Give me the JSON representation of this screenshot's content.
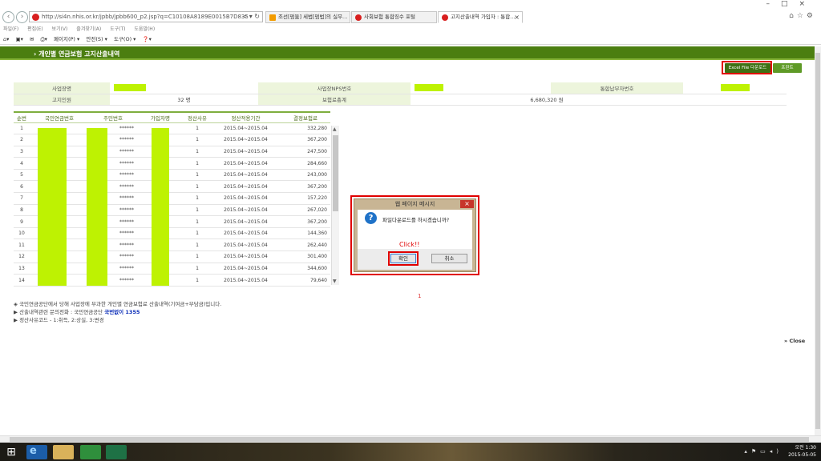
{
  "browser": {
    "url": "http://si4n.nhis.or.kr/jpbb/jpbb600_p2.jsp?q=C10108A8189E0015B7D835C979620E2'",
    "tabs": [
      {
        "label": "조선[펌뚫] 세법[펌법]의 실무..."
      },
      {
        "label": "사회보험 통합징수 포털"
      },
      {
        "label": "고지산출내역 가입자 : 통합...",
        "active": true
      }
    ],
    "menu": [
      "파일(F)",
      "편집(E)",
      "보기(V)",
      "즐겨찾기(A)",
      "도구(T)",
      "도움말(H)"
    ],
    "commands": [
      "페이지(P) ▾",
      "안전(S) ▾",
      "도구(O) ▾"
    ]
  },
  "page": {
    "title": "› 개인별 연금보험 고지산출내역",
    "excel_button": "Excel File 다운로드",
    "print_button": "프린트",
    "info": {
      "business_name_label": "사업장명",
      "nps_no_label": "사업장NPS번호",
      "integrated_payer_label": "통합납부자번호",
      "subscribers_label": "고지인원",
      "subscribers_value": "32 명",
      "total_premium_label": "보험료총계",
      "total_premium_value": "6,680,320 원"
    },
    "grid": {
      "headers": [
        "순번",
        "국민연금번호",
        "주민번호",
        "가입자명",
        "정산사유",
        "정산적용기간",
        "결정보험료"
      ],
      "rows": [
        {
          "no": "1",
          "rrn": "******",
          "reason": "1",
          "period": "2015.04~2015.04",
          "amount": "332,280"
        },
        {
          "no": "2",
          "rrn": "******",
          "reason": "1",
          "period": "2015.04~2015.04",
          "amount": "367,200"
        },
        {
          "no": "3",
          "rrn": "******",
          "reason": "1",
          "period": "2015.04~2015.04",
          "amount": "247,500"
        },
        {
          "no": "4",
          "rrn": "******",
          "reason": "1",
          "period": "2015.04~2015.04",
          "amount": "284,660"
        },
        {
          "no": "5",
          "rrn": "******",
          "reason": "1",
          "period": "2015.04~2015.04",
          "amount": "243,000"
        },
        {
          "no": "6",
          "rrn": "******",
          "reason": "1",
          "period": "2015.04~2015.04",
          "amount": "367,200"
        },
        {
          "no": "7",
          "rrn": "******",
          "reason": "1",
          "period": "2015.04~2015.04",
          "amount": "157,220"
        },
        {
          "no": "8",
          "rrn": "******",
          "reason": "1",
          "period": "2015.04~2015.04",
          "amount": "267,020"
        },
        {
          "no": "9",
          "rrn": "******",
          "reason": "1",
          "period": "2015.04~2015.04",
          "amount": "367,200"
        },
        {
          "no": "10",
          "rrn": "******",
          "reason": "1",
          "period": "2015.04~2015.04",
          "amount": "144,360"
        },
        {
          "no": "11",
          "rrn": "******",
          "reason": "1",
          "period": "2015.04~2015.04",
          "amount": "262,440"
        },
        {
          "no": "12",
          "rrn": "******",
          "reason": "1",
          "period": "2015.04~2015.04",
          "amount": "301,400"
        },
        {
          "no": "13",
          "rrn": "******",
          "reason": "1",
          "period": "2015.04~2015.04",
          "amount": "344,600"
        },
        {
          "no": "14",
          "rrn": "******",
          "reason": "1",
          "period": "2015.04~2015.04",
          "amount": "79,640"
        }
      ]
    },
    "page_number": "1",
    "notes": {
      "line1": "◈ 국민연금공단에서 당해 사업장에 부과한 개인별 연금보험료 산출내역(기여금+부담금)입니다.",
      "line2_prefix": "▶ 산출내역관련 문의전화 : 국민연금공단",
      "line2_phone": "국번없이 1355",
      "line3": "▶ 정산사유코드 - 1:취득, 2:상실, 3:변경"
    },
    "close_link": "» Close"
  },
  "dialog": {
    "title": "웹 페이지 메시지",
    "message": "파일다운로드를 하시겠습니까?",
    "annotation": "Click!!",
    "ok": "확인",
    "cancel": "취소"
  },
  "taskbar": {
    "time": "오전 1:30",
    "date": "2015-05-05"
  }
}
